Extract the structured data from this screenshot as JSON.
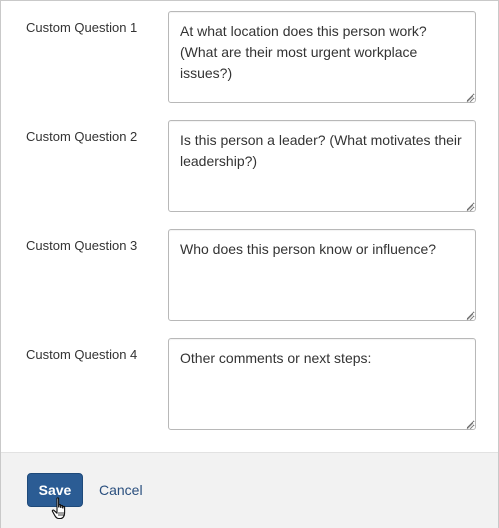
{
  "questions": [
    {
      "label": "Custom Question 1",
      "value": "At what location does this person work? (What are their most urgent workplace issues?)"
    },
    {
      "label": "Custom Question 2",
      "value": "Is this person a leader? (What motivates their leadership?)"
    },
    {
      "label": "Custom Question 3",
      "value": "Who does this person know or influence?"
    },
    {
      "label": "Custom Question 4",
      "value": "Other comments or next steps:"
    }
  ],
  "footer": {
    "save_label": "Save",
    "cancel_label": "Cancel"
  },
  "colors": {
    "primary": "#2b5c94",
    "link": "#2a4f7e",
    "footer_bg": "#f2f2f2"
  },
  "icons": {
    "resize_handle": "resize-grip-icon",
    "cursor": "hand-pointer-icon"
  }
}
